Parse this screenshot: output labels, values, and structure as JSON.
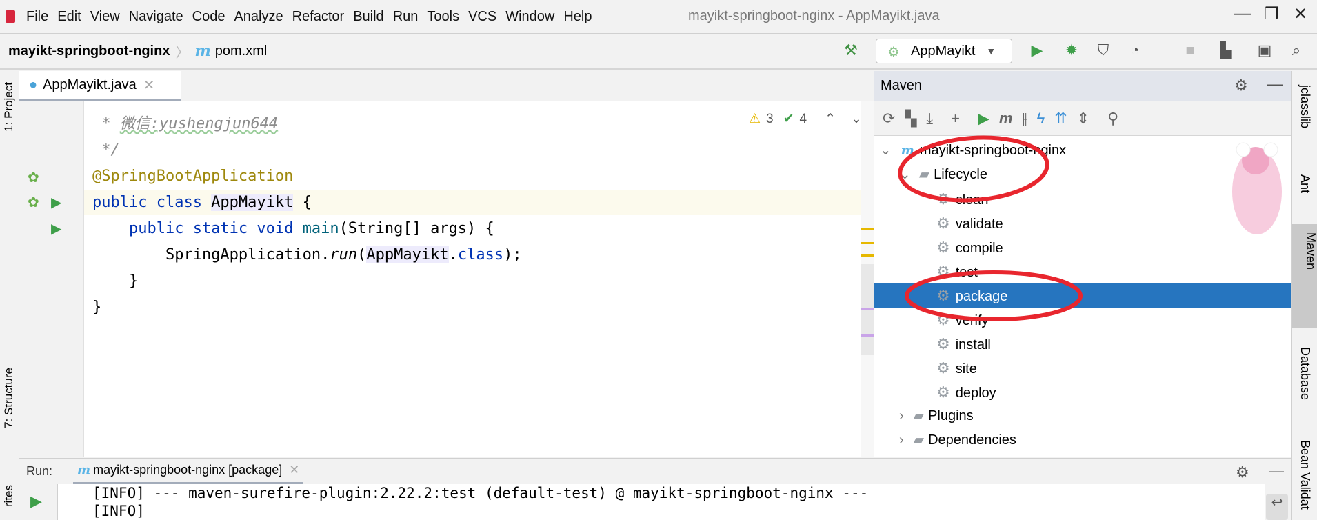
{
  "menu": [
    "File",
    "Edit",
    "View",
    "Navigate",
    "Code",
    "Analyze",
    "Refactor",
    "Build",
    "Run",
    "Tools",
    "VCS",
    "Window",
    "Help"
  ],
  "window_title": "mayikt-springboot-nginx - AppMayikt.java",
  "breadcrumb": {
    "project": "mayikt-springboot-nginx",
    "file": "pom.xml"
  },
  "run_config": "AppMayikt",
  "editor_tab": "AppMayikt.java",
  "inspections": {
    "warnings": "3",
    "weak_warnings": "4"
  },
  "code": {
    "l1_star": " * ",
    "l1_text": "微信:yushengjun644",
    "l2": " */",
    "l3": "@SpringBootApplication",
    "l4_kw": "public class ",
    "l4_name": "AppMayikt",
    "l4_end": " {",
    "l5_kw": "    public static void ",
    "l5_m": "main",
    "l5_end": "(String[] args) {",
    "l6_a": "        SpringApplication.",
    "l6_run": "run",
    "l6_b": "(",
    "l6_name": "AppMayikt",
    "l6_dot": ".",
    "l6_cls": "class",
    "l6_end": ");",
    "l7": "    }",
    "l8": "}"
  },
  "maven": {
    "title": "Maven",
    "project": "mayikt-springboot-nginx",
    "lifecycle": "Lifecycle",
    "phases": [
      "clean",
      "validate",
      "compile",
      "test",
      "package",
      "verify",
      "install",
      "site",
      "deploy"
    ],
    "selected": "package",
    "plugins": "Plugins",
    "dependencies": "Dependencies"
  },
  "left_tabs": {
    "project": "1: Project",
    "structure": "7: Structure",
    "favorites": "rites"
  },
  "right_tabs": {
    "jclasslib": "jclasslib",
    "ant": "Ant",
    "maven": "Maven",
    "database": "Database",
    "bean": "Bean Validat"
  },
  "run": {
    "label": "Run:",
    "tab": "mayikt-springboot-nginx [package]",
    "lines": [
      "[INFO] --- maven-surefire-plugin:2.22.2:test (default-test) @ mayikt-springboot-nginx ---",
      "[INFO]"
    ]
  },
  "colors": {
    "selection": "#2675bf",
    "annotation_ring": "#e8262e",
    "keyword": "#0033b3"
  }
}
